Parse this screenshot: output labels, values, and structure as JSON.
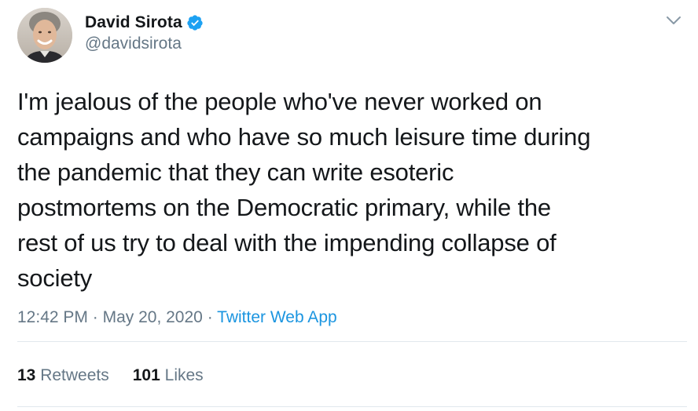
{
  "author": {
    "display_name": "David Sirota",
    "handle": "@davidsirota",
    "verified_icon": "verified-badge-icon"
  },
  "tweet": {
    "text": "I'm jealous of the people who've never worked on\ncampaigns and who have so much leisure time during\nthe pandemic that they can write esoteric\npostmortems on the Democratic primary, while the\nrest of us try to deal with the impending collapse of\nsociety",
    "time": "12:42 PM",
    "date": "May 20, 2020",
    "separator": "·",
    "source": "Twitter Web App"
  },
  "stats": {
    "retweets_count": "13",
    "retweets_label": "Retweets",
    "likes_count": "101",
    "likes_label": "Likes"
  },
  "colors": {
    "verified": "#1da1f2",
    "link": "#1b95e0",
    "secondary_text": "#657786",
    "divider": "#e1e8ed"
  }
}
